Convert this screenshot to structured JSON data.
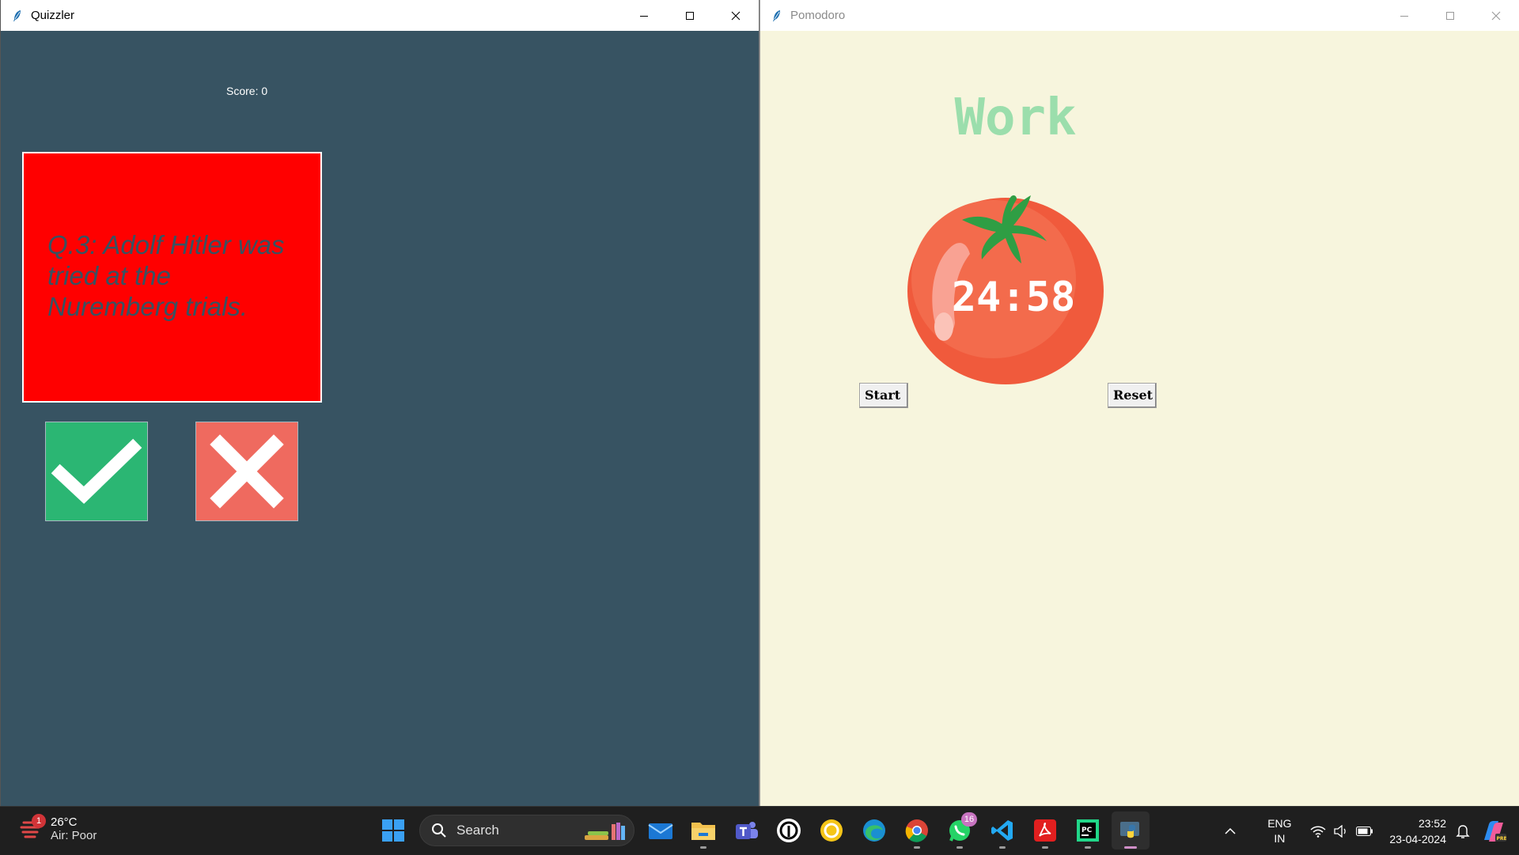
{
  "quizzler": {
    "window_title": "Quizzler",
    "score_text": "Score: 0",
    "question_text": "Q.3: Adolf Hitler was tried at the Nuremberg trials.",
    "true_button_icon": "check-icon",
    "false_button_icon": "cross-icon",
    "colors": {
      "background": "#375362",
      "card": "#ff0000",
      "true": "#2bb673",
      "false": "#ef6a5f"
    }
  },
  "pomodoro": {
    "window_title": "Pomodoro",
    "heading": "Work",
    "timer": "24:58",
    "start_label": "Start",
    "reset_label": "Reset",
    "colors": {
      "background": "#f7f5dd",
      "heading": "#9bdeac"
    }
  },
  "window_controls": {
    "minimize_icon": "minimize-icon",
    "maximize_icon": "maximize-icon",
    "close_icon": "close-icon"
  },
  "taskbar": {
    "weather": {
      "badge": "1",
      "temp": "26°C",
      "air": "Air: Poor"
    },
    "search_label": "Search",
    "pinned": [
      {
        "name": "start-menu-icon"
      },
      {
        "name": "mail-icon"
      },
      {
        "name": "file-explorer-icon"
      },
      {
        "name": "teams-icon"
      },
      {
        "name": "threads-icon"
      },
      {
        "name": "norton-icon"
      },
      {
        "name": "edge-icon"
      },
      {
        "name": "chrome-icon"
      },
      {
        "name": "whatsapp-icon",
        "badge": "16"
      },
      {
        "name": "vscode-icon"
      },
      {
        "name": "acrobat-icon"
      },
      {
        "name": "pycharm-icon"
      },
      {
        "name": "python-icon"
      }
    ],
    "language": {
      "line1": "ENG",
      "line2": "IN"
    },
    "time": "23:52",
    "date": "23-04-2024"
  }
}
